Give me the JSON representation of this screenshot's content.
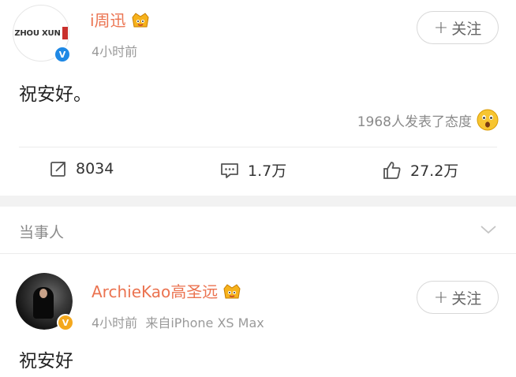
{
  "post1": {
    "username": "i周迅",
    "avatar_text": "ZHOU XUN",
    "time": "4小时前",
    "follow_label": "关注",
    "content": "祝安好。",
    "reaction_text": "1968人发表了态度",
    "actions": {
      "repost_count": "8034",
      "comment_count": "1.7万",
      "like_count": "27.2万"
    }
  },
  "section": {
    "title": "当事人"
  },
  "post2": {
    "username": "ArchieKao高圣远",
    "meta": "4小时前  来自iPhone XS Max",
    "follow_label": "关注",
    "content": "祝安好"
  },
  "colors": {
    "username": "#eb7350",
    "verified_blue": "#1e88e5",
    "verified_gold": "#f4a81d",
    "muted": "#9a9a9a"
  },
  "icons": [
    "crown-badge-icon",
    "verified-badge-icon",
    "plus-icon",
    "shocked-face-icon",
    "repost-icon",
    "comment-icon",
    "like-icon",
    "chevron-down-icon"
  ]
}
